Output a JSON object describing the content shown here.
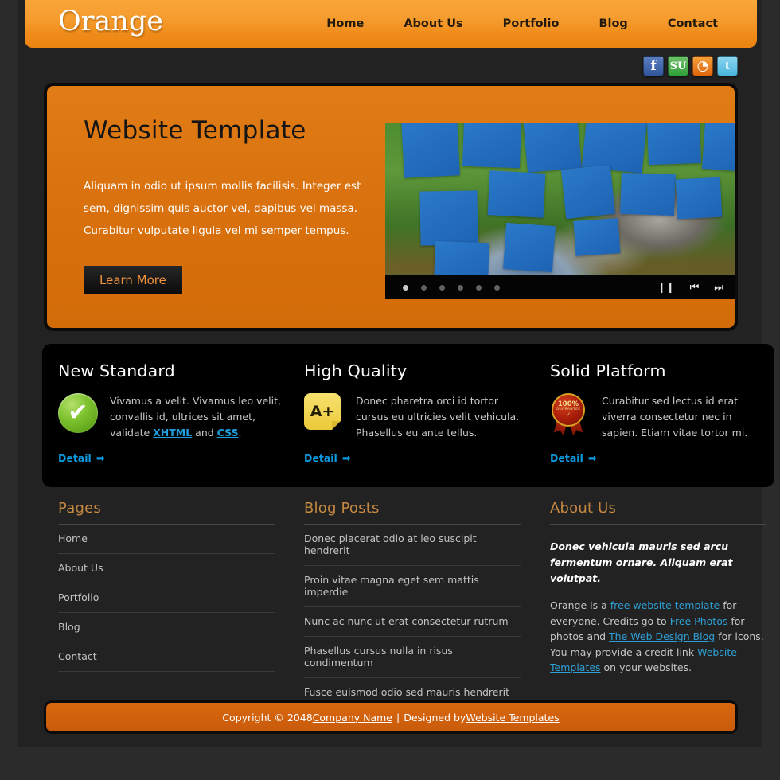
{
  "site": {
    "logo": "Orange",
    "nav": [
      {
        "label": "Home"
      },
      {
        "label": "About Us"
      },
      {
        "label": "Portfolio"
      },
      {
        "label": "Blog"
      },
      {
        "label": "Contact"
      }
    ],
    "social": [
      {
        "name": "facebook-icon",
        "glyph": "f"
      },
      {
        "name": "stumbleupon-icon",
        "glyph": "SU"
      },
      {
        "name": "rss-icon",
        "glyph": "◔"
      },
      {
        "name": "twitter-icon",
        "glyph": "t"
      }
    ]
  },
  "banner": {
    "title": "Website Template",
    "description": "Aliquam in odio ut ipsum mollis facilisis. Integer est sem, dignissim quis auctor vel, dapibus vel massa. Curabitur vulputate ligula vel mi semper tempus.",
    "button_label": "Learn More",
    "slider": {
      "dot_count": 6,
      "active_dot": 1,
      "controls": [
        {
          "name": "pause-button",
          "glyph": "❙❙"
        },
        {
          "name": "previous-button",
          "glyph": "⏮"
        },
        {
          "name": "next-button",
          "glyph": "⏭"
        }
      ]
    }
  },
  "features": [
    {
      "title": "New Standard",
      "icon": "green-check-icon",
      "text_before": "Vivamus a velit. Vivamus leo velit, convallis id, ultrices sit amet, validate ",
      "link1": "XHTML",
      "text_mid": " and ",
      "link2": "CSS",
      "text_after": ".",
      "detail_label": "Detail"
    },
    {
      "title": "High Quality",
      "icon": "a-plus-grade-icon",
      "text_before": "Donec pharetra orci id tortor cursus eu ultricies velit vehicula. Phasellus eu ante tellus.",
      "detail_label": "Detail"
    },
    {
      "title": "Solid Platform",
      "icon": "guarantee-badge-icon",
      "text_before": "Curabitur sed lectus id erat viverra consectetur nec in sapien. Etiam vitae tortor mi.",
      "detail_label": "Detail"
    }
  ],
  "badge": {
    "percent": "100%",
    "word": "GUARANTEE",
    "check": "✓"
  },
  "aplus_label": "A+",
  "check_glyph": "✔",
  "arrow_glyph": "➡",
  "footer": {
    "pages": {
      "heading": "Pages",
      "items": [
        {
          "label": "Home"
        },
        {
          "label": "About Us"
        },
        {
          "label": "Portfolio"
        },
        {
          "label": "Blog"
        },
        {
          "label": "Contact"
        }
      ]
    },
    "blog": {
      "heading": "Blog Posts",
      "items": [
        {
          "label": "Donec placerat odio at leo suscipit hendrerit"
        },
        {
          "label": "Proin vitae magna eget sem mattis imperdie"
        },
        {
          "label": "Nunc ac nunc ut erat consectetur rutrum"
        },
        {
          "label": "Phasellus cursus nulla in risus condimentum"
        },
        {
          "label": "Fusce euismod odio sed mauris hendrerit"
        }
      ]
    },
    "about": {
      "heading": "About Us",
      "lead": "Donec vehicula mauris sed arcu fermentum ornare. Aliquam erat volutpat.",
      "p1": "Orange is a ",
      "link1": "free website template",
      "p2": " for everyone. Credits go to ",
      "link2": "Free Photos",
      "p3": " for photos and ",
      "link3": "The Web Design Blog",
      "p4": " for icons. You may provide a credit link ",
      "link4": "Website Templates",
      "p5": " on your websites."
    }
  },
  "copyright": {
    "prefix": "Copyright © 2048 ",
    "company": "Company Name",
    "separator": "|",
    "designed_by": "Designed by ",
    "designer": "Website Templates"
  },
  "colors": {
    "header_orange": "#f59a2c",
    "banner_orange": "#d8700d",
    "link_blue": "#2e9fd4",
    "heading_tan": "#c58840",
    "features_bg": "#000000",
    "page_bg": "#222222"
  }
}
